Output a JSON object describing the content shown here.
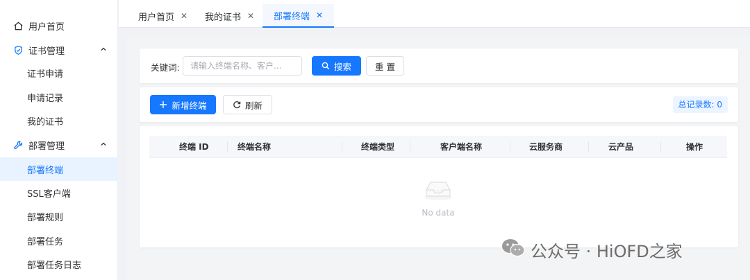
{
  "sidebar": {
    "items": [
      {
        "label": "用户首页",
        "icon": "home-icon"
      },
      {
        "label": "证书管理",
        "icon": "shield-check-icon"
      },
      {
        "label": "证书申请"
      },
      {
        "label": "申请记录"
      },
      {
        "label": "我的证书"
      },
      {
        "label": "部署管理",
        "icon": "wrench-icon"
      },
      {
        "label": "部署终端"
      },
      {
        "label": "SSL客户端"
      },
      {
        "label": "部署规则"
      },
      {
        "label": "部署任务"
      },
      {
        "label": "部署任务日志"
      }
    ]
  },
  "tabs": [
    {
      "label": "用户首页"
    },
    {
      "label": "我的证书"
    },
    {
      "label": "部署终端"
    }
  ],
  "search": {
    "keyword_label": "关键词:",
    "placeholder": "请输入终端名称、客户...",
    "search_label": "搜索",
    "reset_label": "重 置"
  },
  "toolbar": {
    "add_label": "新增终端",
    "refresh_label": "刷新",
    "total_label": "总记录数: 0"
  },
  "table": {
    "columns": [
      "终端 ID",
      "终端名称",
      "终端类型",
      "客户端名称",
      "云服务商",
      "云产品",
      "操作"
    ],
    "rows": [],
    "empty_text": "No data"
  },
  "watermark": {
    "text": "公众号 · HiOFD之家"
  },
  "colors": {
    "primary": "#1677ff",
    "active_bg": "#e8f3ff",
    "page_bg": "#f3f4f6"
  }
}
